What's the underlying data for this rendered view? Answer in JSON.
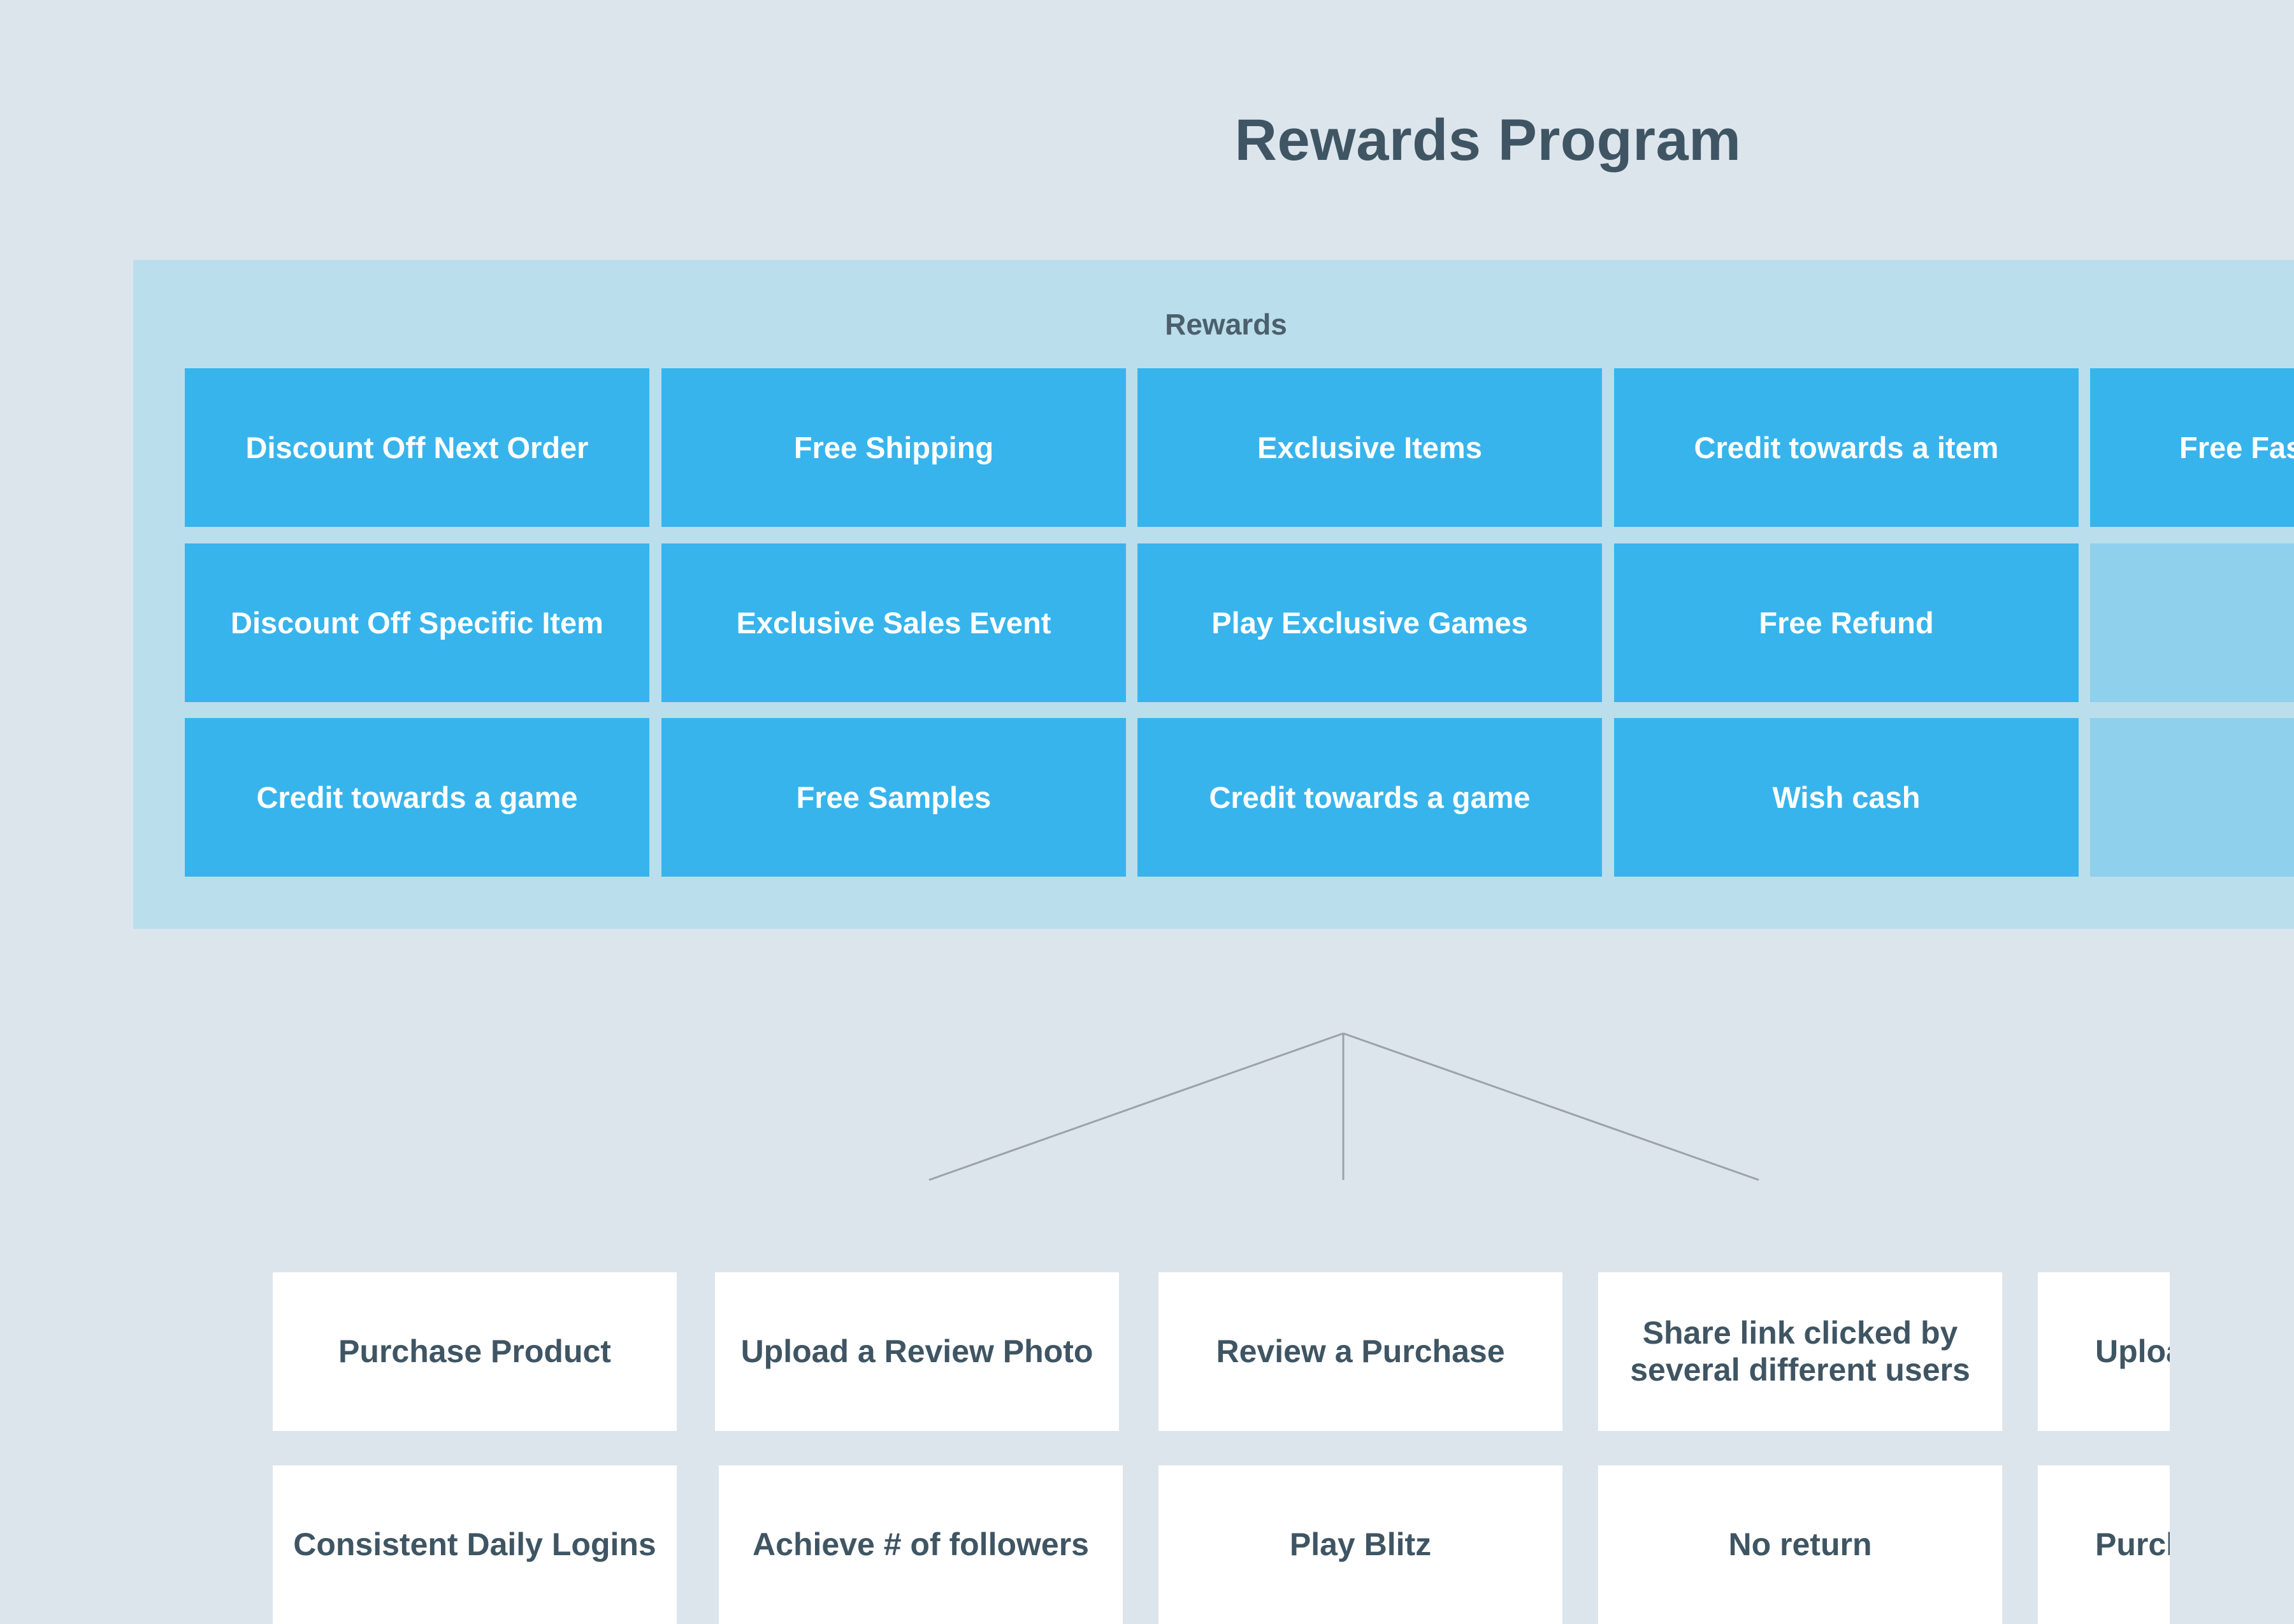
{
  "title": "Rewards Program",
  "rewards": {
    "label": "Rewards",
    "tiles": [
      "Discount Off Next Order",
      "Free Shipping",
      "Exclusive Items",
      "Credit towards a item",
      "Free Fas",
      "Discount Off Specific Item",
      "Exclusive Sales Event",
      "Play Exclusive Games",
      "Free Refund",
      "",
      "Credit towards a game",
      "Free Samples",
      "Credit towards a game",
      "Wish cash",
      ""
    ]
  },
  "actions": {
    "cards": [
      "Purchase Product",
      "Upload a Review Photo",
      "Review a Purchase",
      "Share link clicked by several different users",
      "Upload pro picture",
      "Consistent Daily Logins",
      "Achieve # of followers",
      "Play Blitz",
      "No return",
      "Purchased ar for X consec months"
    ]
  },
  "colors": {
    "background": "#dde5ec",
    "panel": "#bbdeec",
    "tile": "#38b4ec",
    "tile_empty": "#8fd0ec",
    "card": "#ffffff",
    "text_dark": "#3f5563",
    "connector": "#9aa3a8"
  }
}
